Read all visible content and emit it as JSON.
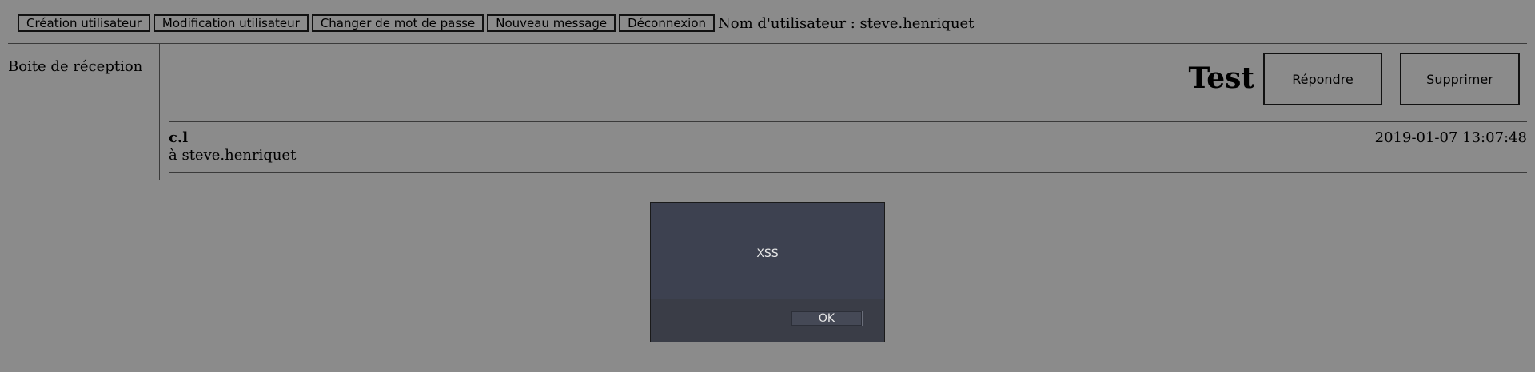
{
  "toolbar": {
    "buttons": [
      "Création utilisateur",
      "Modification utilisateur",
      "Changer de mot de passe",
      "Nouveau message",
      "Déconnexion"
    ],
    "user_label": "Nom d'utilisateur : steve.henriquet"
  },
  "sidebar": {
    "inbox_label": "Boite de réception"
  },
  "message": {
    "subject": "Test",
    "reply_label": "Répondre",
    "delete_label": "Supprimer",
    "sender": "c.l",
    "recipient": "à steve.henriquet",
    "timestamp": "2019-01-07 13:07:48"
  },
  "dialog": {
    "message": "XSS",
    "ok_label": "OK"
  },
  "colors": {
    "page_background": "#8b8b8b",
    "dialog_background": "#3d4150"
  }
}
